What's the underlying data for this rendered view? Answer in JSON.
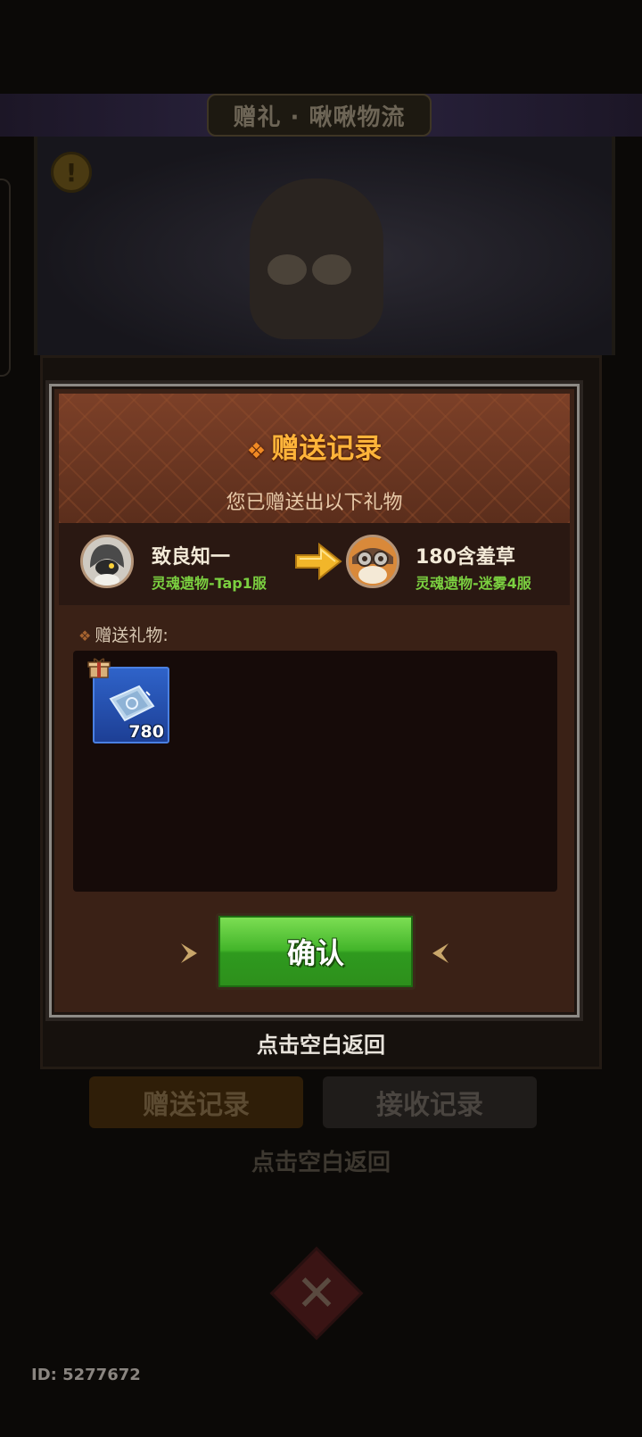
{
  "background": {
    "banner_title": "赠礼 · 啾啾物流",
    "tabs": [
      {
        "label": "赠送记录"
      },
      {
        "label": "接收记录"
      }
    ],
    "tap_return": "点击空白返回",
    "player_id": "ID: 5277672"
  },
  "dialog": {
    "title": "赠送记录",
    "subtitle": "您已赠送出以下礼物",
    "sender": {
      "name": "致良知一",
      "server": "灵魂遗物-Tap1服"
    },
    "receiver": {
      "name": "180含羞草",
      "server": "灵魂遗物-迷雾4服"
    },
    "gifts_label": "赠送礼物:",
    "gifts": [
      {
        "icon": "ticket-icon",
        "count": "780"
      }
    ],
    "confirm_label": "确认"
  },
  "tap_return_text": "点击空白返回",
  "colors": {
    "title": "#ffb43a",
    "server_text": "#7bd040",
    "confirm_button": "#43b52a",
    "item_slot": "#2f63c9"
  }
}
